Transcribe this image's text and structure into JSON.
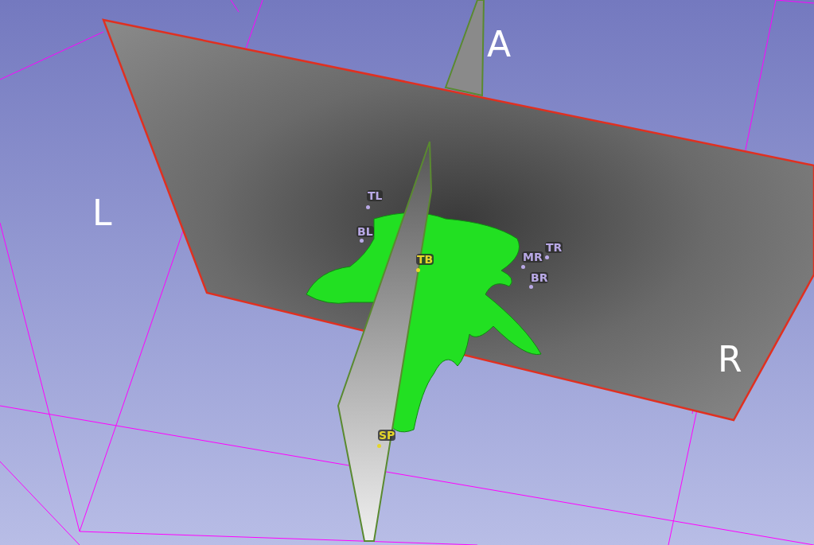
{
  "view": {
    "orientation_labels": [
      {
        "text": "A"
      },
      {
        "text": "L"
      },
      {
        "text": "R"
      }
    ]
  },
  "markups": [
    {
      "label": "TL",
      "color": "#b9a9e6"
    },
    {
      "label": "BL",
      "color": "#b9a9e6"
    },
    {
      "label": "TB",
      "color": "#e6d62a"
    },
    {
      "label": "MR",
      "color": "#b9a9e6"
    },
    {
      "label": "TR",
      "color": "#b9a9e6"
    },
    {
      "label": "BR",
      "color": "#b9a9e6"
    },
    {
      "label": "SP",
      "color": "#e6d62a"
    }
  ]
}
